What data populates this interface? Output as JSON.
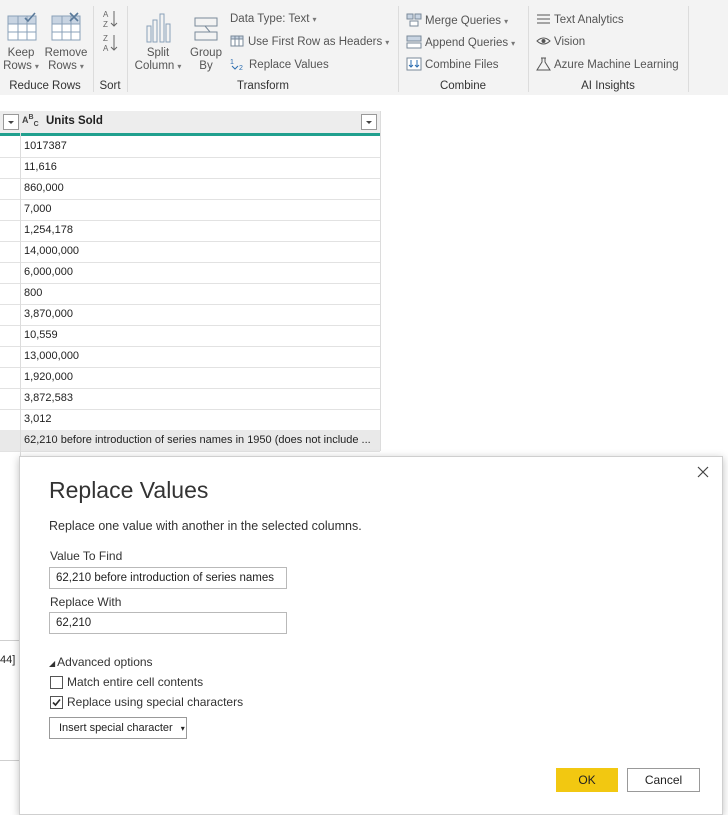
{
  "ribbon": {
    "reduce_rows": {
      "keep_rows": [
        "Keep",
        "Rows"
      ],
      "remove_rows": [
        "Remove",
        "Rows"
      ],
      "group_label": "Reduce Rows"
    },
    "sort": {
      "group_label": "Sort"
    },
    "transform": {
      "split_column": [
        "Split",
        "Column"
      ],
      "group_by": [
        "Group",
        "By"
      ],
      "data_type": "Data Type: Text",
      "use_first_row": "Use First Row as Headers",
      "replace_values": "Replace Values",
      "group_label": "Transform"
    },
    "combine": {
      "merge_queries": "Merge Queries",
      "append_queries": "Append Queries",
      "combine_files": "Combine Files",
      "group_label": "Combine"
    },
    "ai_insights": {
      "text_analytics": "Text Analytics",
      "vision": "Vision",
      "azure_ml": "Azure Machine Learning",
      "group_label": "AI Insights"
    }
  },
  "grid": {
    "column_header": "Units Sold",
    "type_icon": "ABC",
    "rows": [
      "1017387",
      "11,616",
      "860,000",
      "7,000",
      "1,254,178",
      "14,000,000",
      "6,000,000",
      "800",
      "3,870,000",
      "10,559",
      "13,000,000",
      "1,920,000",
      "3,872,583",
      "3,012",
      "62,210 before introduction of series names in 1950 (does not include ..."
    ],
    "side_fragment": "44]"
  },
  "dialog": {
    "title": "Replace Values",
    "description": "Replace one value with another in the selected columns.",
    "value_to_find_label": "Value To Find",
    "value_to_find": "62,210 before introduction of series names",
    "replace_with_label": "Replace With",
    "replace_with": "62,210",
    "advanced_options": "Advanced options",
    "match_entire_cell": "Match entire cell contents",
    "match_entire_cell_checked": false,
    "replace_special": "Replace using special characters",
    "replace_special_checked": true,
    "insert_special": "Insert special character",
    "ok": "OK",
    "cancel": "Cancel"
  },
  "colors": {
    "accent_teal": "#20a08e",
    "ok_yellow": "#f2c811",
    "ribbon_bg": "#f3f3f3"
  }
}
